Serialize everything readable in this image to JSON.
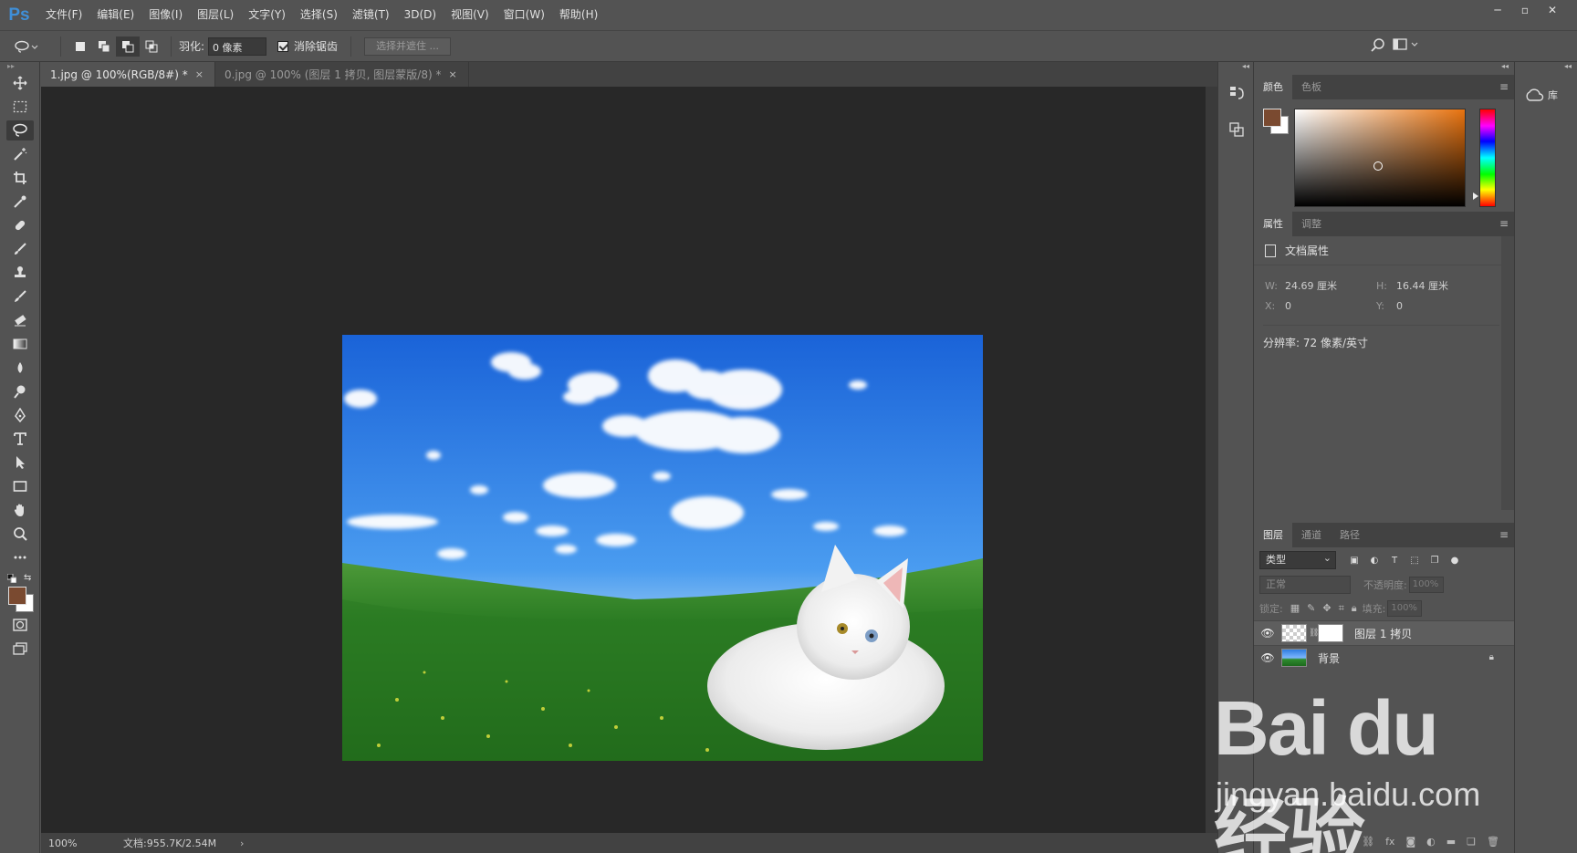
{
  "app": {
    "logo": "Ps"
  },
  "menu": [
    "文件(F)",
    "编辑(E)",
    "图像(I)",
    "图层(L)",
    "文字(Y)",
    "选择(S)",
    "滤镜(T)",
    "3D(D)",
    "视图(V)",
    "窗口(W)",
    "帮助(H)"
  ],
  "window_controls": {
    "minimize": "─",
    "restore": "▫",
    "close": "✕"
  },
  "options": {
    "feather_label": "羽化:",
    "feather_value": "0 像素",
    "antialias_label": "消除锯齿",
    "select_mask_button": "选择并遮住 ..."
  },
  "tabs": [
    {
      "label": "1.jpg @ 100%(RGB/8#) *",
      "close": "×"
    },
    {
      "label": "0.jpg @ 100% (图层 1 拷贝, 图层蒙版/8) *",
      "close": "×"
    }
  ],
  "status": {
    "zoom": "100%",
    "docinfo": "文档:955.7K/2.54M",
    "arrow": "›"
  },
  "color_panel": {
    "tab_color": "颜色",
    "tab_swatches": "色板",
    "fg_color": "#7a4a30",
    "bg_color": "#ffffff"
  },
  "properties_panel": {
    "tab_properties": "属性",
    "tab_adjustments": "调整",
    "doc_props": "文档属性",
    "w_label": "W:",
    "w_value": "24.69 厘米",
    "h_label": "H:",
    "h_value": "16.44 厘米",
    "x_label": "X:",
    "x_value": "0",
    "y_label": "Y:",
    "y_value": "0",
    "resolution": "分辨率: 72 像素/英寸"
  },
  "layers_panel": {
    "tab_layers": "图层",
    "tab_channels": "通道",
    "tab_paths": "路径",
    "kind": "类型",
    "blend_mode": "正常",
    "opacity_label": "不透明度:",
    "opacity_value": "100%",
    "lock_label": "锁定:",
    "fill_label": "填充:",
    "fill_value": "100%",
    "layers": [
      {
        "name": "图层 1 拷贝"
      },
      {
        "name": "背景"
      }
    ]
  },
  "library": {
    "label": "库"
  },
  "watermark": {
    "line1": "Bai du 经验",
    "line2": "jingyan.baidu.com"
  }
}
